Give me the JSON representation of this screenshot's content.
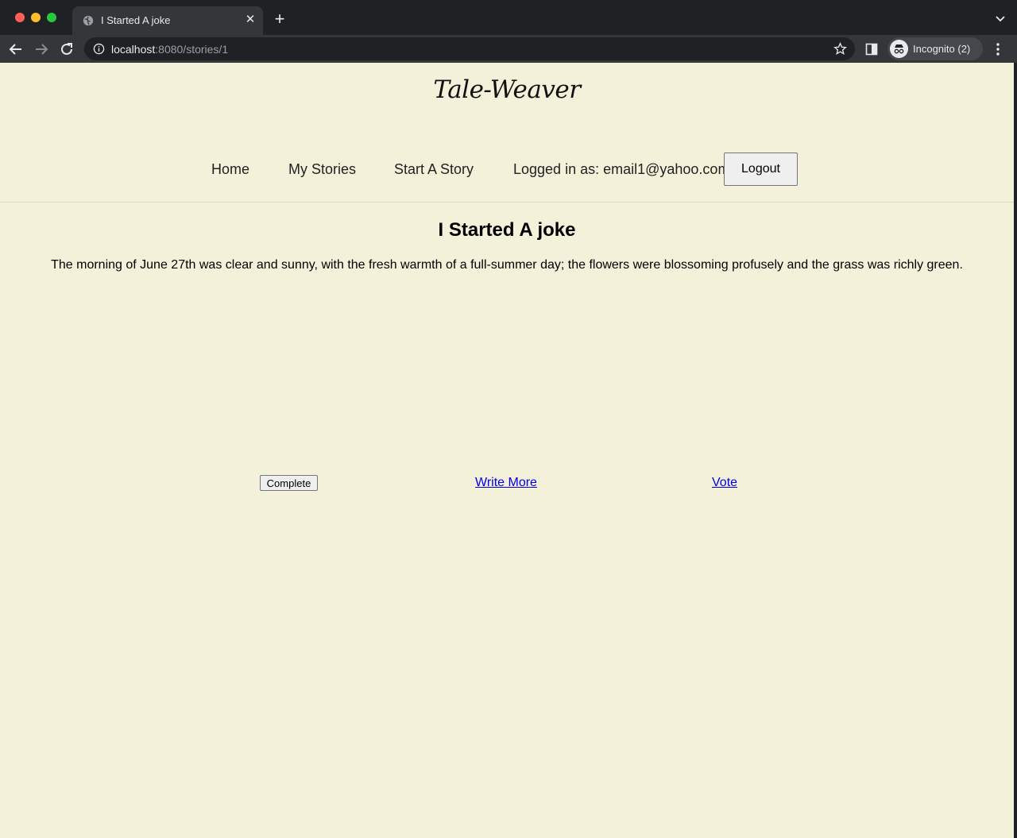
{
  "browser": {
    "tab_title": "I Started A joke",
    "url_host": "localhost",
    "url_path": ":8080/stories/1",
    "profile_label": "Incognito (2)"
  },
  "site": {
    "logo": "Tale-Weaver",
    "nav": {
      "home": "Home",
      "my_stories": "My Stories",
      "start_story": "Start A Story",
      "logged_in": "Logged in as: email1@yahoo.com",
      "logout": "Logout"
    }
  },
  "story": {
    "title": "I Started A joke",
    "text": "The morning of June 27th was clear and sunny, with the fresh warmth of a full-summer day; the flowers were blossoming profusely and the grass was richly green.",
    "complete_label": "Complete",
    "write_more_label": "Write More",
    "vote_label": "Vote"
  },
  "colors": {
    "page_background": "#f4f1da",
    "link": "#0000ee"
  }
}
